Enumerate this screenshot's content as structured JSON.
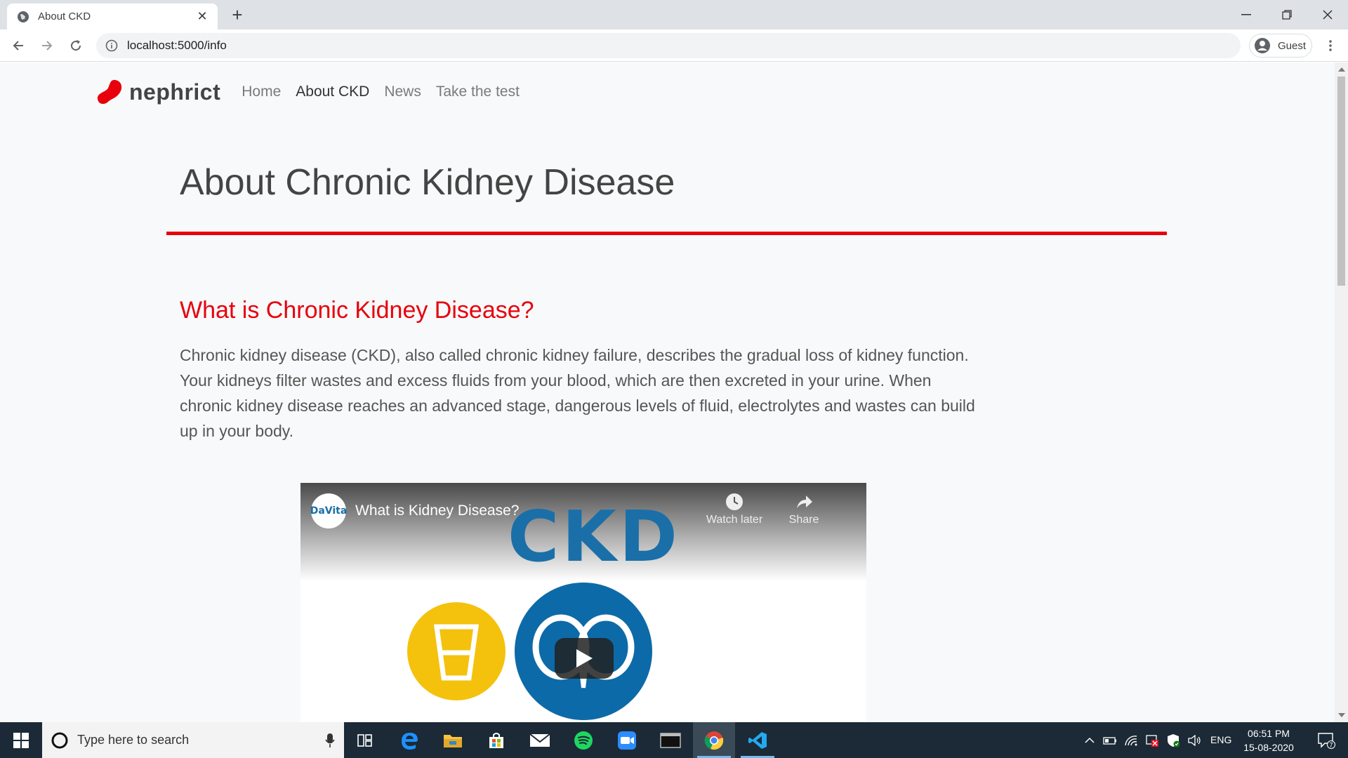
{
  "browser": {
    "tab_title": "About CKD",
    "url": "localhost:5000/info",
    "profile_label": "Guest"
  },
  "navbar": {
    "brand": "nephrict",
    "links": [
      "Home",
      "About CKD",
      "News",
      "Take the test"
    ],
    "active_link": "About CKD"
  },
  "page": {
    "title": "About Chronic Kidney Disease",
    "section_heading": "What is Chronic Kidney Disease?",
    "section_body": "Chronic kidney disease (CKD), also called chronic kidney failure, describes the gradual loss of kidney function. Your kidneys filter wastes and excess fluids from your blood, which are then excreted in your urine. When chronic kidney disease reaches an advanced stage, dangerous levels of fluid, electrolytes and wastes can build up in your body."
  },
  "video": {
    "channel": "DaVita",
    "title": "What is Kidney Disease?",
    "overlay_text": "CKD",
    "watch_later_label": "Watch later",
    "share_label": "Share"
  },
  "taskbar": {
    "search_placeholder": "Type here to search",
    "language": "ENG",
    "time": "06:51 PM",
    "date": "15-08-2020",
    "notification_count": "7"
  },
  "colors": {
    "accent_red": "#e8000c",
    "page_background": "#f8f9fa",
    "taskbar": "#1b2a36"
  }
}
